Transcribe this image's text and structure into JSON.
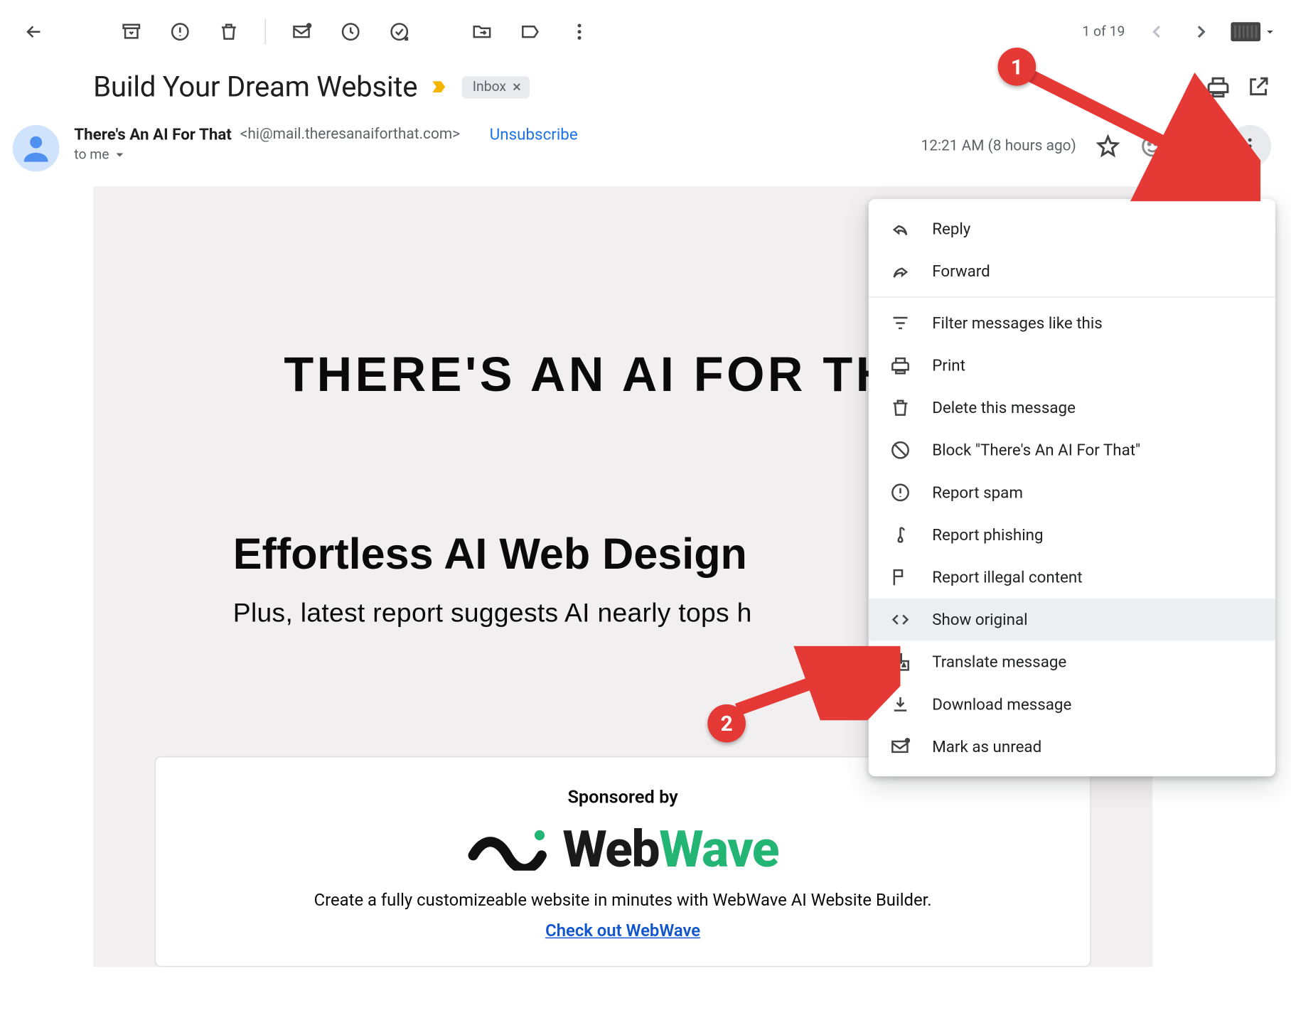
{
  "toolbar": {
    "count": "1 of 19"
  },
  "subject": {
    "title": "Build Your Dream Website",
    "chip": "Inbox"
  },
  "sender": {
    "name": "There's An AI For That",
    "email": "<hi@mail.theresanaiforthat.com>",
    "unsubscribe": "Unsubscribe",
    "to": "to me",
    "date": "12:21 AM (8 hours ago)"
  },
  "menu": {
    "reply": "Reply",
    "forward": "Forward",
    "filter": "Filter messages like this",
    "print": "Print",
    "delete": "Delete this message",
    "block": "Block \"There's An AI For That\"",
    "spam": "Report spam",
    "phishing": "Report phishing",
    "illegal": "Report illegal content",
    "show_original": "Show original",
    "translate": "Translate message",
    "download": "Download message",
    "unread": "Mark as unread"
  },
  "body": {
    "brand": "THERE'S AN AI FOR THAT",
    "h2": "Effortless AI Web Design",
    "sub": "Plus, latest report suggests AI nearly tops h"
  },
  "sponsor": {
    "label": "Sponsored by",
    "brand_web": "Web",
    "brand_wave": "Wave",
    "desc": "Create a fully customizeable website in minutes with WebWave AI Website Builder.",
    "link": "Check out WebWave"
  },
  "callouts": {
    "c1": "1",
    "c2": "2"
  }
}
